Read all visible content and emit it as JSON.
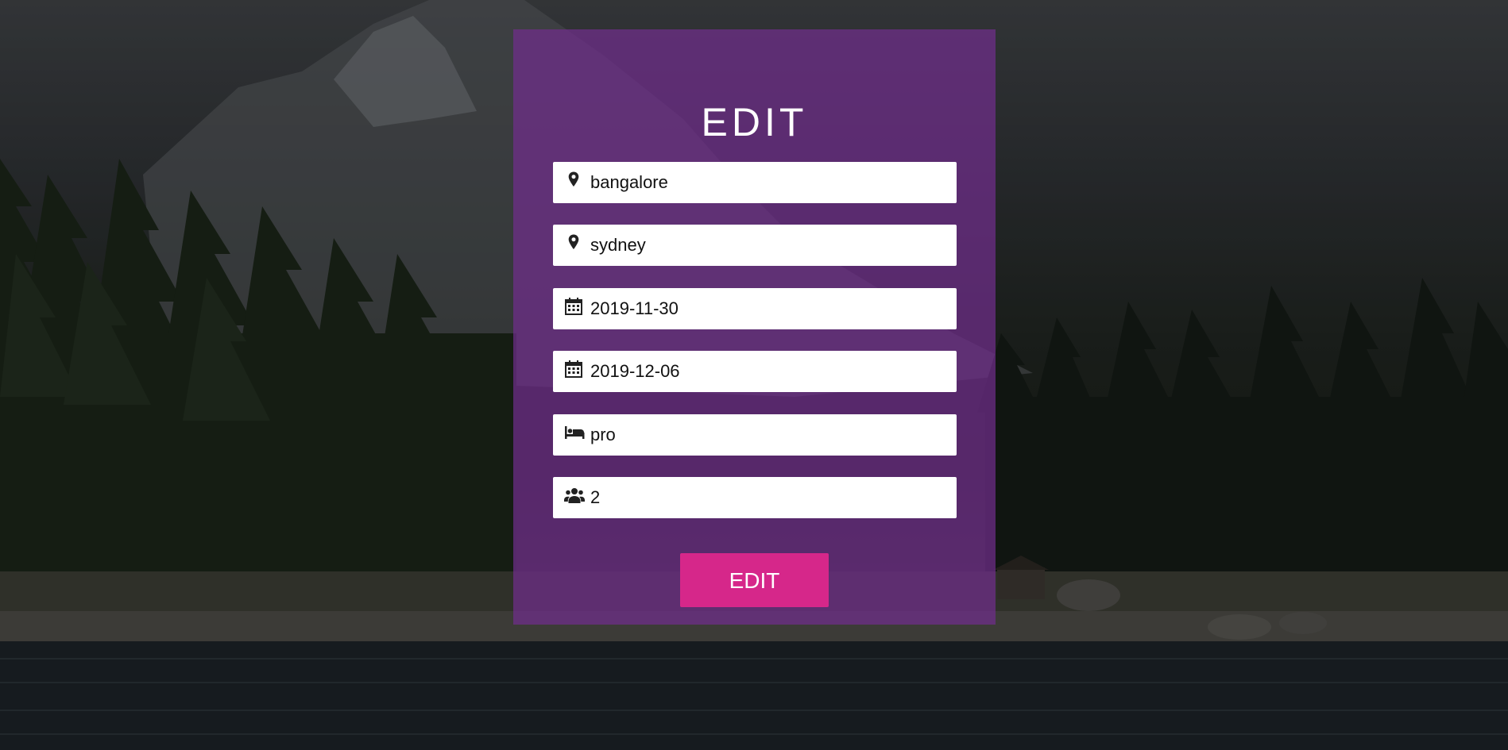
{
  "form": {
    "title": "EDIT",
    "fields": [
      {
        "icon": "map-marker-icon",
        "value": "bangalore"
      },
      {
        "icon": "map-marker-icon",
        "value": "sydney"
      },
      {
        "icon": "calendar-icon",
        "value": "2019-11-30"
      },
      {
        "icon": "calendar-icon",
        "value": "2019-12-06"
      },
      {
        "icon": "bed-icon",
        "value": "pro"
      },
      {
        "icon": "users-icon",
        "value": "2"
      }
    ],
    "submit_label": "EDIT"
  },
  "colors": {
    "panel": "#702e8c",
    "button": "#d6278a",
    "field_bg": "#ffffff",
    "title_text": "#ffffff"
  }
}
